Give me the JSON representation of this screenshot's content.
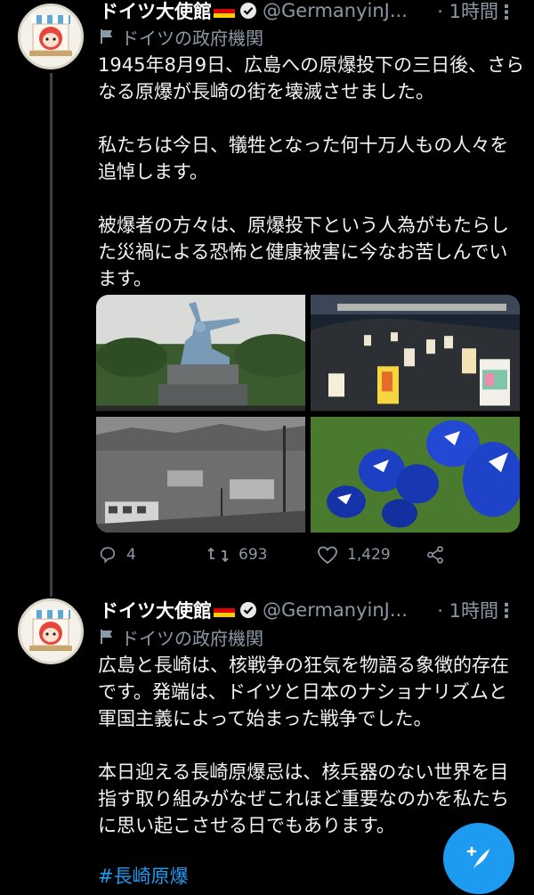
{
  "tweets": [
    {
      "display_name": "ドイツ大使館",
      "handle": "@GermanyinJ...",
      "time": "· 1時間",
      "label": "ドイツの政府機関",
      "text": "1945年8月9日、広島への原爆投下の三日後、さらなる原爆が長崎の街を壊滅させました。\n\n私たちは今日、犠牲となった何十万人もの人々を追悼します。\n\n被爆者の方々は、原爆投下という人為がもたらした災禍による恐怖と健康被害に今なお苦しんでいます。",
      "stats": {
        "replies": "4",
        "retweets": "693",
        "likes": "1,429"
      }
    },
    {
      "display_name": "ドイツ大使館",
      "handle": "@GermanyinJ...",
      "time": "· 1時間",
      "label": "ドイツの政府機関",
      "text": "広島と長崎は、核戦争の狂気を物語る象徴的存在です。発端は、ドイツと日本のナショナリズムと軍国主義によって始まった戦争でした。\n\n本日迎える長崎原爆忌は、核兵器のない世界を目指す取り組みがなぜこれほど重要なのかを私たちに思い起こさせる日でもあります。",
      "hashtag": "#長崎原爆"
    }
  ],
  "media_photos": [
    "peace-statue-photo",
    "memorial-lanterns-photo",
    "ruined-city-photo",
    "blue-dove-balloons-photo"
  ],
  "colors": {
    "accent": "#1d9bf0",
    "muted": "#8b98a5",
    "background": "#000000"
  },
  "icons": [
    "reply-icon",
    "retweet-icon",
    "like-icon",
    "share-icon",
    "verified-icon",
    "government-flag-icon",
    "more-icon",
    "compose-icon"
  ]
}
